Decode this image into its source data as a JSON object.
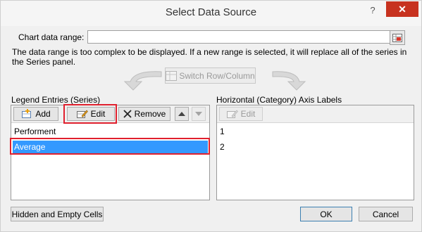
{
  "window": {
    "title": "Select Data Source",
    "help_glyph": "?",
    "close_glyph": "✕"
  },
  "chart_range": {
    "label": "Chart data range:",
    "value": ""
  },
  "note": "The data range is too complex to be displayed. If a new range is selected, it will replace all of the series in the Series panel.",
  "switch_button": "Switch Row/Column",
  "legend": {
    "heading": "Legend Entries (Series)",
    "add_label": "Add",
    "edit_label": "Edit",
    "remove_label": "Remove",
    "items": [
      "Performent",
      "Average"
    ]
  },
  "axis": {
    "heading": "Horizontal (Category) Axis Labels",
    "edit_label": "Edit",
    "items": [
      "1",
      "2"
    ]
  },
  "footer": {
    "hidden_label": "Hidden and Empty Cells",
    "ok_label": "OK",
    "cancel_label": "Cancel"
  },
  "colors": {
    "selection": "#3399ff",
    "highlight": "#e0202e",
    "close": "#c7321f"
  }
}
